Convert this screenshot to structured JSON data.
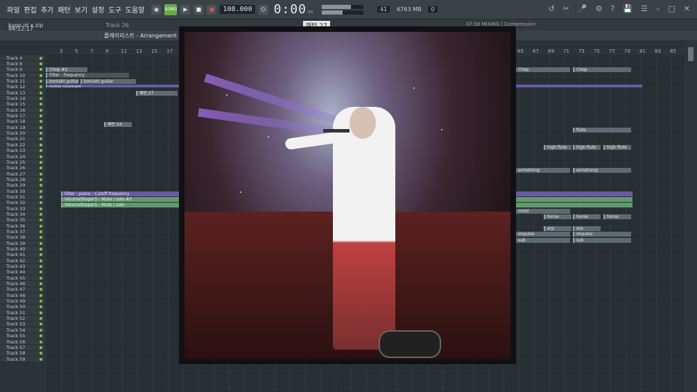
{
  "menu": [
    "파일",
    "편집",
    "추가",
    "패턴",
    "보기",
    "설정",
    "도구",
    "도움말"
  ],
  "transport": {
    "song_label": "SONG",
    "tempo": "108.000",
    "time": "0:00",
    "time_sub": "00",
    "mscs": "M:S:CS"
  },
  "cpu": {
    "value1": "41",
    "ram": "6763 MB",
    "value2": "0"
  },
  "bar2": {
    "file": "kygo id x.zip",
    "track": "Track 26",
    "pattern": "패턴 27",
    "mixing": "07:58 MIXING | Compression"
  },
  "timecode": "84:12:17",
  "playlist": {
    "title": "플레이리스트 - Arrangement"
  },
  "ruler": [
    "3",
    "5",
    "7",
    "9",
    "11",
    "13",
    "15",
    "17",
    "65",
    "67",
    "69",
    "71",
    "73",
    "75",
    "77",
    "79",
    "81",
    "83",
    "85"
  ],
  "tracks": [
    "Track 4",
    "Track 6",
    "Track 9",
    "Track 10",
    "Track 11",
    "Track 12",
    "Track 13",
    "Track 14",
    "Track 15",
    "Track 16",
    "Track 17",
    "Track 18",
    "Track 19",
    "Track 20",
    "Track 21",
    "Track 22",
    "Track 23",
    "Track 24",
    "Track 25",
    "Track 26",
    "Track 27",
    "Track 28",
    "Track 29",
    "Track 30",
    "Track 31",
    "Track 32",
    "Track 33",
    "Track 34",
    "Track 35",
    "Track 36",
    "Track 37",
    "Track 38",
    "Track 39",
    "Track 40",
    "Track 41",
    "Track 42",
    "Track 43",
    "Track 44",
    "Track 45",
    "Track 46",
    "Track 47",
    "Track 48",
    "Track 49",
    "Track 50",
    "Track 51",
    "Track 52",
    "Track 53",
    "Track 54",
    "Track 55",
    "Track 56",
    "Track 57",
    "Track 58",
    "Track 59"
  ],
  "clips": {
    "chop": "Chop #2",
    "filter": "Filter - frequency",
    "kontakt": "kontakt guitar",
    "guitar": "guitar snapped",
    "pattern27": "패턴 27",
    "pattern24": "패턴 24",
    "flute": "flute",
    "high_flute": "high flute",
    "armstrong": "armstrong",
    "filter_piano": "Filter - piano - Cutoff frequency",
    "vs_mute2": "VolumeShaper5 - Mute / solo #2",
    "vs_mute": "VolumeShaper5 - Mute / solo",
    "mstd": "mstd",
    "horse": "horse",
    "arp": "arp",
    "impulse": "impulse",
    "sub": "sub",
    "chop_r": "Chop"
  }
}
